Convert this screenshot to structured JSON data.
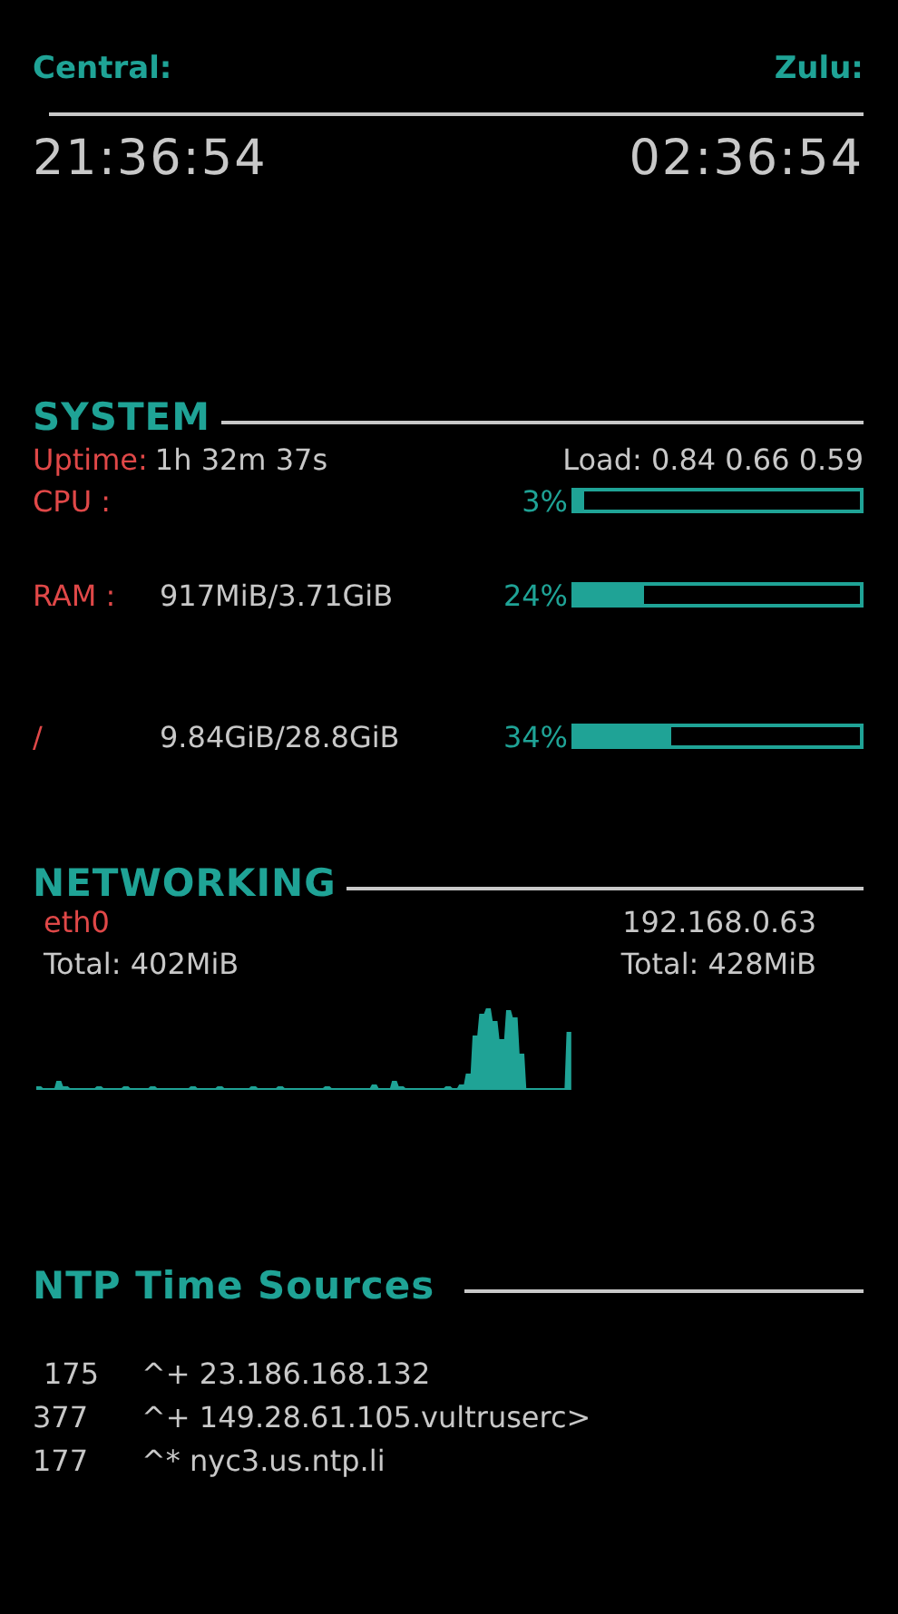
{
  "clocks": [
    {
      "label": "Central:",
      "time": "21:36:54"
    },
    {
      "label": "Zulu:",
      "time": "02:36:54"
    }
  ],
  "system": {
    "title": "SYSTEM",
    "uptime_label": "Uptime:",
    "uptime": "1h 32m 37s",
    "load": "Load: 0.84 0.66 0.59",
    "meters": [
      {
        "kind": "cpu",
        "label": "CPU :",
        "percent": "3%",
        "level": 0.03
      },
      {
        "kind": "ram",
        "label": "RAM :",
        "value": "917MiB/3.71GiB",
        "percent": "24%",
        "level": 0.24
      },
      {
        "kind": "disk",
        "label": "/",
        "value": "9.84GiB/28.8GiB",
        "percent": "34%",
        "level": 0.34
      }
    ]
  },
  "networking": {
    "title": "NETWORKING",
    "interface": "eth0",
    "address": "192.168.0.63",
    "down_total": "Total: 402MiB",
    "up_total": "Total: 428MiB"
  },
  "ntp": {
    "title": "NTP Time Sources",
    "sources": [
      {
        "reach": "175",
        "source": "^+ 23.186.168.132"
      },
      {
        "reach": "377",
        "source": "^+ 149.28.61.105.vultruserc>"
      },
      {
        "reach": "177",
        "source": "^* nyc3.us.ntp.li"
      }
    ]
  }
}
